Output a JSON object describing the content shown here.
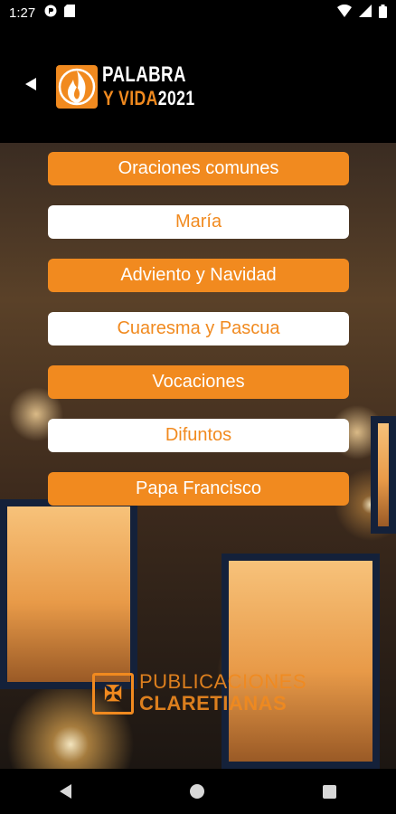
{
  "status_bar": {
    "time": "1:27",
    "icons": [
      "notification-icon",
      "sd-card-icon",
      "wifi-icon",
      "signal-icon",
      "battery-icon"
    ]
  },
  "header": {
    "logo_line1": "PALABRA",
    "logo_line2a": "Y VIDA",
    "logo_line2b": "2021"
  },
  "menu": {
    "items": [
      {
        "label": "Oraciones comunes",
        "style": "filled"
      },
      {
        "label": "María",
        "style": "outline"
      },
      {
        "label": "Adviento y Navidad",
        "style": "filled"
      },
      {
        "label": "Cuaresma y Pascua",
        "style": "outline"
      },
      {
        "label": "Vocaciones",
        "style": "filled"
      },
      {
        "label": "Difuntos",
        "style": "outline"
      },
      {
        "label": "Papa Francisco",
        "style": "filled"
      }
    ]
  },
  "publisher": {
    "line1": "PUBLICACIONES",
    "line2": "CLARETIANAS"
  },
  "colors": {
    "accent": "#f18a1f",
    "background": "#000000"
  }
}
